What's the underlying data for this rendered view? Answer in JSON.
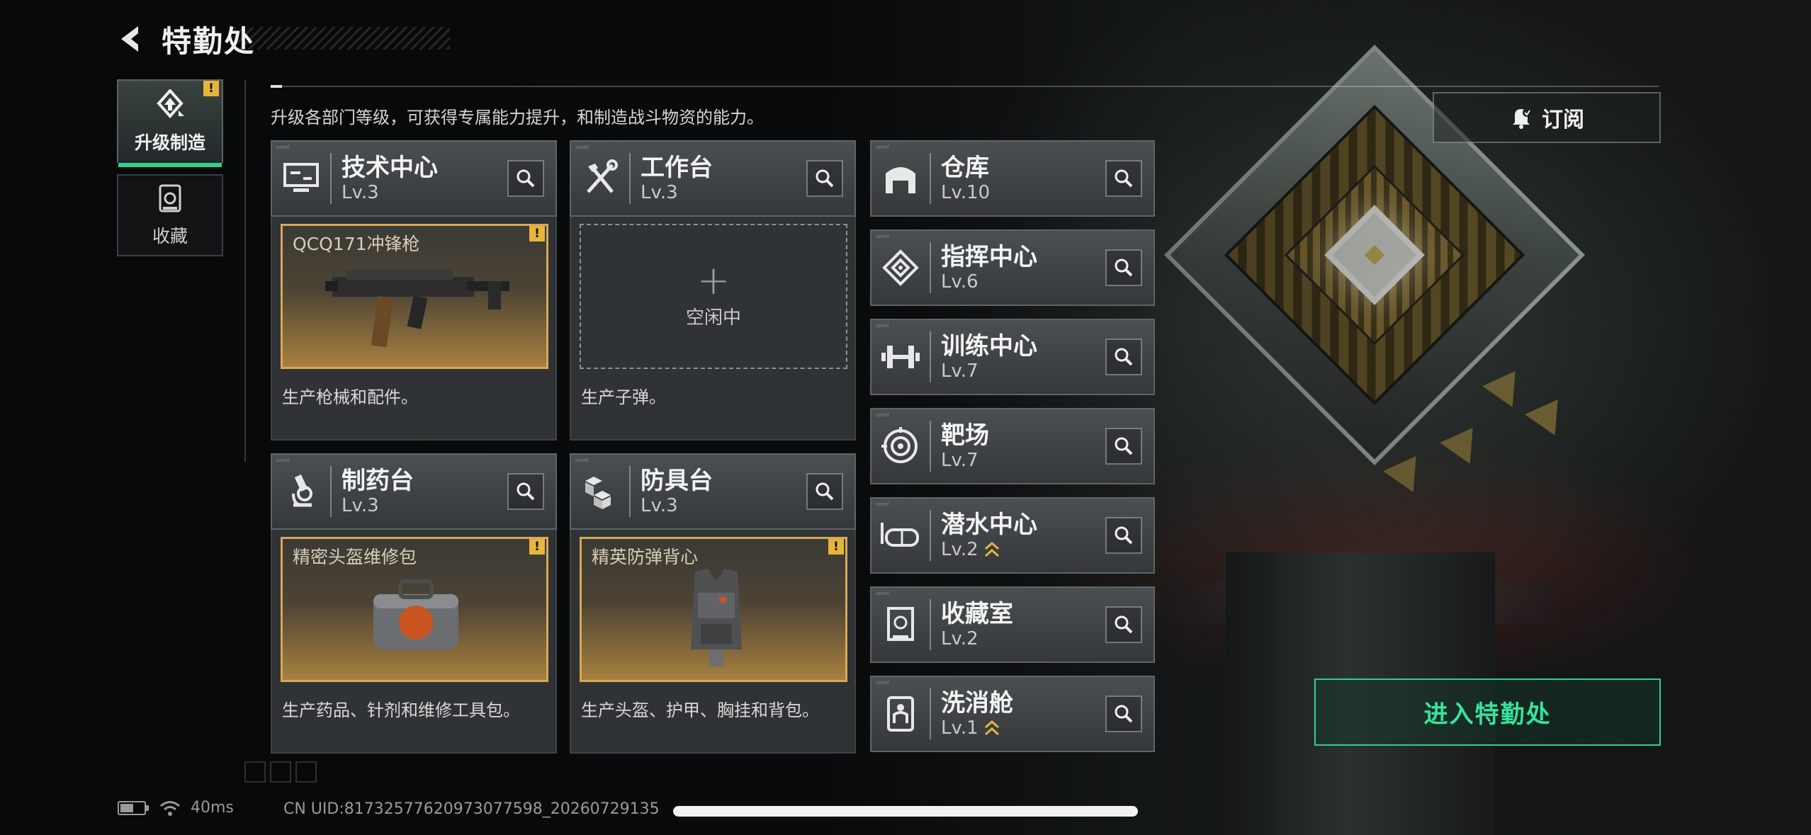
{
  "header": {
    "title": "特勤处"
  },
  "subtitle": "升级各部门等级，可获得专属能力提升，和制造战斗物资的能力。",
  "side_tabs": [
    {
      "label": "升级制造",
      "badge": "!"
    },
    {
      "label": "收藏"
    }
  ],
  "departments_main": [
    {
      "name": "技术中心",
      "level": "Lv.3",
      "slot_item": "QCQ171冲锋枪",
      "badge": "!",
      "desc": "生产枪械和配件。"
    },
    {
      "name": "工作台",
      "level": "Lv.3",
      "slot_state": "空闲中",
      "desc": "生产子弹。"
    },
    {
      "name": "制药台",
      "level": "Lv.3",
      "slot_item": "精密头盔维修包",
      "badge": "!",
      "desc": "生产药品、针剂和维修工具包。"
    },
    {
      "name": "防具台",
      "level": "Lv.3",
      "slot_item": "精英防弹背心",
      "badge": "!",
      "desc": "生产头盔、护甲、胸挂和背包。"
    }
  ],
  "departments_side": [
    {
      "name": "仓库",
      "level": "Lv.10"
    },
    {
      "name": "指挥中心",
      "level": "Lv.6"
    },
    {
      "name": "训练中心",
      "level": "Lv.7"
    },
    {
      "name": "靶场",
      "level": "Lv.7"
    },
    {
      "name": "潜水中心",
      "level": "Lv.2",
      "upgradable": true
    },
    {
      "name": "收藏室",
      "level": "Lv.2"
    },
    {
      "name": "洗消舱",
      "level": "Lv.1",
      "upgradable": true
    }
  ],
  "buttons": {
    "subscribe": "订阅",
    "enter": "进入特勤处"
  },
  "status": {
    "ping": "40ms",
    "uid": "CN UID:81732577620973077598_20260729135"
  },
  "colors": {
    "accent_green": "#2fd08a",
    "warn_yellow": "#e7b53c",
    "slot_gold": "#d7a955"
  }
}
